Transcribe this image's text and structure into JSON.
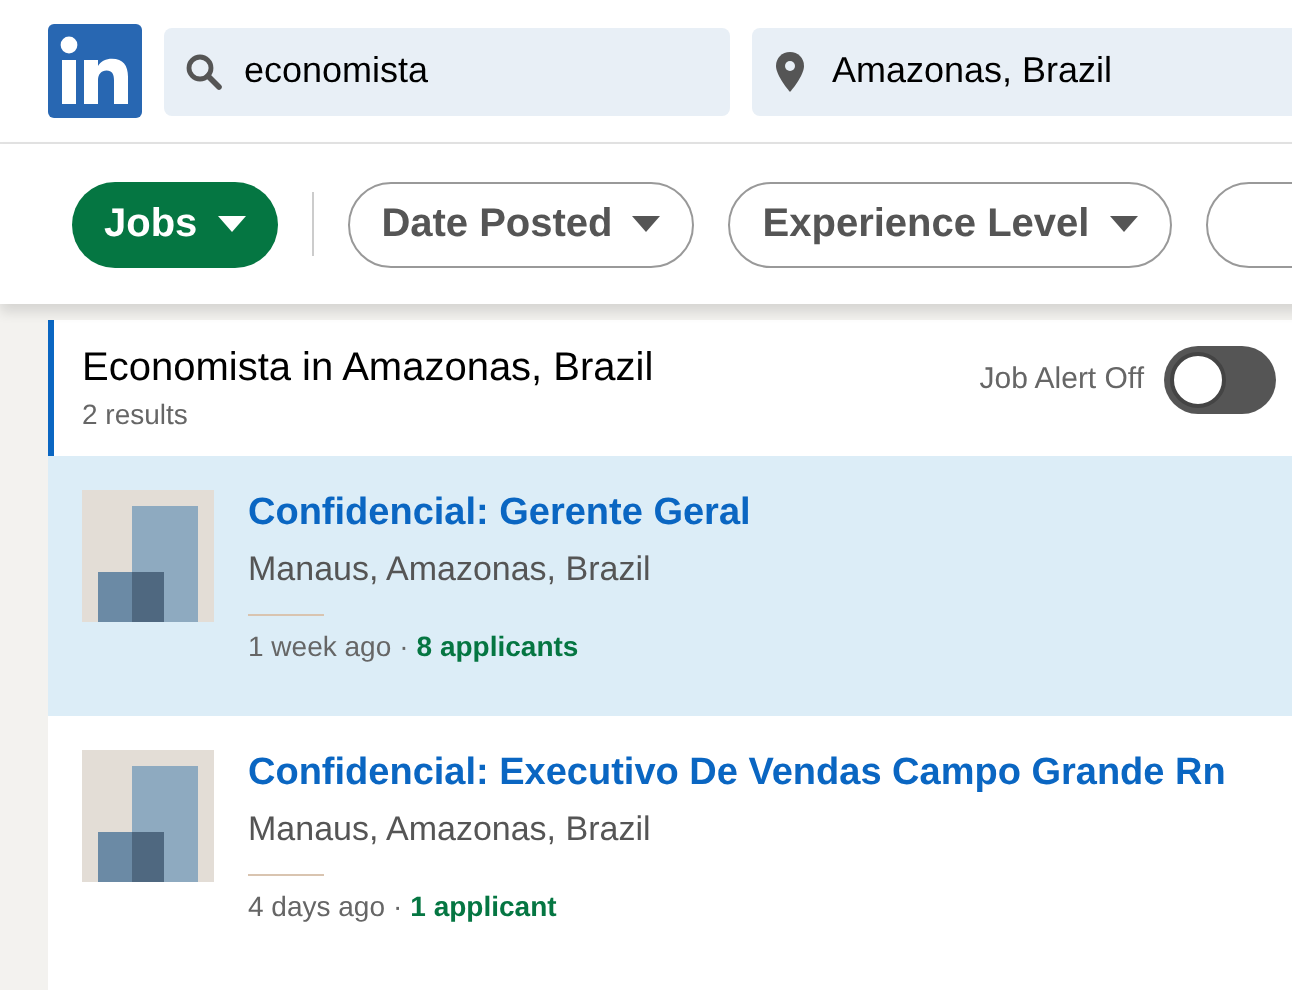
{
  "search": {
    "value": "economista"
  },
  "location": {
    "value": "Amazonas, Brazil"
  },
  "filters": [
    {
      "label": "Jobs",
      "selected": true
    },
    {
      "label": "Date Posted",
      "selected": false
    },
    {
      "label": "Experience Level",
      "selected": false
    }
  ],
  "results": {
    "title": "Economista in Amazonas, Brazil",
    "count": "2 results",
    "job_alert": {
      "label": "Job Alert Off",
      "on": false
    }
  },
  "jobs": [
    {
      "title": "Confidencial: Gerente Geral",
      "location": "Manaus, Amazonas, Brazil",
      "posted": "1 week ago",
      "separator": "·",
      "applicants": "8 applicants",
      "selected": true
    },
    {
      "title": "Confidencial: Executivo De Vendas Campo Grande Rn",
      "location": "Manaus, Amazonas, Brazil",
      "posted": "4 days ago",
      "separator": "·",
      "applicants": "1 applicant",
      "selected": false
    }
  ]
}
